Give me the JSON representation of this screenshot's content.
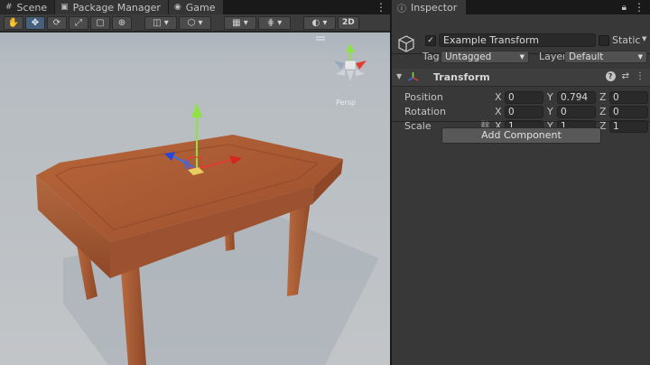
{
  "scene_window": {
    "tabs": [
      {
        "label": "Scene",
        "icon": "hash-icon"
      },
      {
        "label": "Package Manager",
        "icon": "package-icon"
      },
      {
        "label": "Game",
        "icon": "gamepad-icon"
      }
    ],
    "toolbar": {
      "mode_2d_label": "2D"
    },
    "gizmo_view_label": "Persp"
  },
  "inspector": {
    "tab_label": "Inspector",
    "object": {
      "name": "Example Transform",
      "static_label": "Static",
      "tag_label": "Tag",
      "tag_value": "Untagged",
      "layer_label": "Layer",
      "layer_value": "Default"
    },
    "transform": {
      "title": "Transform",
      "position": {
        "label": "Position",
        "x": "0",
        "y": "0.794",
        "z": "0"
      },
      "rotation": {
        "label": "Rotation",
        "x": "0",
        "y": "0",
        "z": "0"
      },
      "scale": {
        "label": "Scale",
        "x": "1",
        "y": "1",
        "z": "1"
      },
      "axis_x": "X",
      "axis_y": "Y",
      "axis_z": "Z"
    },
    "add_component_label": "Add Component"
  },
  "colors": {
    "panel_bg": "#383838",
    "scene_bg": "#282828",
    "active_tool": "#46607c",
    "axis_x": "#e03c31",
    "axis_y": "#8ee241",
    "axis_z": "#3b6ee6",
    "wood": "#a8572f"
  }
}
